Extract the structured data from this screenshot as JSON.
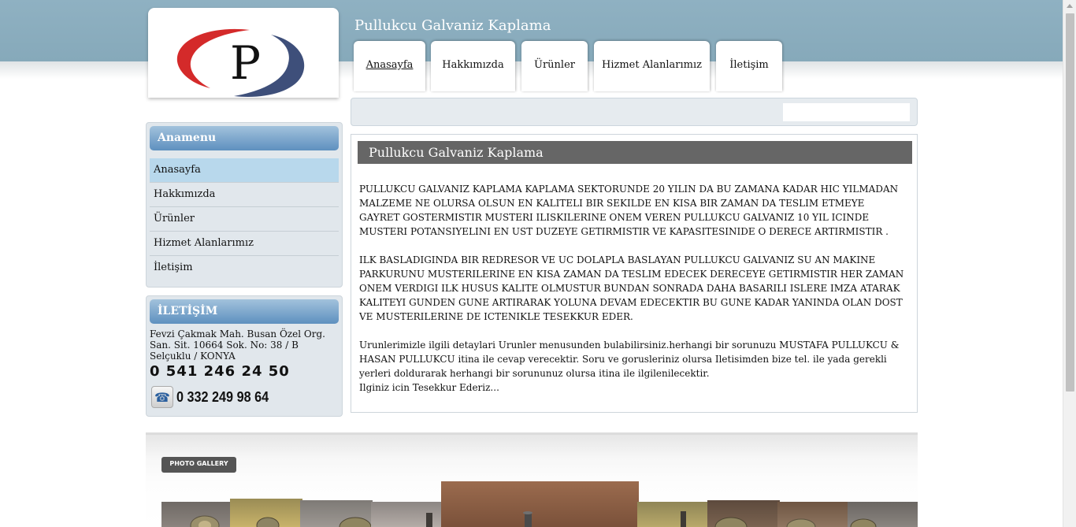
{
  "site": {
    "title": "Pullukcu Galvaniz Kaplama",
    "logo_letter": "P"
  },
  "nav": {
    "tabs": [
      {
        "label": "Anasayfa"
      },
      {
        "label": "Hakkımızda"
      },
      {
        "label": "Ürünler"
      },
      {
        "label": "Hizmet Alanlarımız"
      },
      {
        "label": "İletişim"
      }
    ]
  },
  "search": {
    "value": "",
    "placeholder": ""
  },
  "sidebar": {
    "menu_title": "Anamenu",
    "menu_items": [
      {
        "label": "Anasayfa"
      },
      {
        "label": "Hakkımızda"
      },
      {
        "label": "Ürünler"
      },
      {
        "label": "Hizmet Alanlarımız"
      },
      {
        "label": "İletişim"
      }
    ],
    "contact_title": "İLETİŞİM",
    "address": "Fevzi Çakmak Mah. Busan Özel Org. San. Sit. 10664 Sok. No: 38 / B Selçuklu / KONYA",
    "phone_mobile": "0 541 246 24 50",
    "phone_landline": "0 332 249 98 64"
  },
  "content": {
    "heading": "Pullukcu Galvaniz Kaplama",
    "paragraphs": [
      "PULLUKCU GALVANIZ KAPLAMA  KAPLAMA SEKTORUNDE 20 YILIN DA   BU ZAMANA KADAR HIC YILMADAN  MALZEME NE OLURSA OLSUN  EN KALITELI BIR SEKILDE EN KISA BIR ZAMAN DA TESLIM ETMEYE GAYRET GOSTERMISTIR MUSTERI ILISKILERINE ONEM VEREN PULLUKCU GALVANIZ   10 YIL ICINDE MUSTERI  POTANSIYELINI  EN UST DUZEYE GETIRMISTIR   VE KAPASITESINIDE  O DERECE ARTIRMISTIR .",
      "ILK BASLADIGINDA  BIR REDRESOR VE UC DOLAPLA BASLAYAN PULLUKCU GALVANIZ SU AN  MAKINE PARKURUNU MUSTERILERINE EN KISA ZAMAN DA TESLIM EDECEK DERECEYE GETIRMISTIR   HER ZAMAN ONEM VERDIGI ILK HUSUS KALITE OLMUSTUR  BUNDAN SONRADA DAHA BASARILI ISLERE IMZA ATARAK   KALITEYI GUNDEN GUNE ARTIRARAK  YOLUNA DEVAM EDECEKTIR BU GUNE KADAR YANINDA OLAN DOST VE MUSTERILERINE  DE ICTENIKLE TESEKKUR EDER.",
      "Urunlerimizle ilgili detaylari Urunler menusunden bulabilirsiniz.herhangi bir sorunuzu MUSTAFA PULLUKCU  & HASAN PULLUKCU itina ile cevap verecektir. Soru ve gorusleriniz olursa Iletisimden bize tel. ile yada gerekli yerleri doldurarak herhangi bir sorununuz olursa itina ile ilgilenilecektir.\nIlginiz icin Tesekkur Ederiz..."
    ]
  },
  "gallery": {
    "badge": "PHOTO GALLERY"
  },
  "colors": {
    "header_band": "#8fb1c2",
    "box_head": "#5e90bf",
    "active_menu": "#b8d8ec",
    "content_head": "#666666",
    "logo_red": "#d42a2a",
    "logo_navy": "#3e4f7a"
  },
  "icons": {
    "phone": "telephone-icon",
    "logo": "p-ellipse-logo"
  }
}
